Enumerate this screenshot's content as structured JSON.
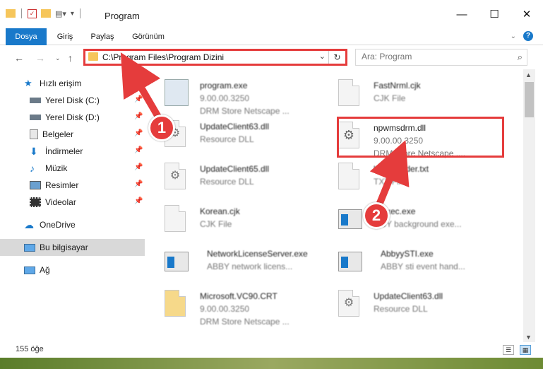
{
  "window": {
    "title": "Program"
  },
  "ribbon": {
    "tabs": [
      "Dosya",
      "Giriş",
      "Paylaş",
      "Görünüm"
    ]
  },
  "address": {
    "path": "C:\\Program Files\\Program Dizini"
  },
  "search": {
    "placeholder": "Ara: Program"
  },
  "sidebar": {
    "items": [
      {
        "label": "Hızlı erişim",
        "icon": "star-icon"
      },
      {
        "label": "Yerel Disk (C:)",
        "icon": "drive-icon"
      },
      {
        "label": "Yerel Disk (D:)",
        "icon": "drive-icon"
      },
      {
        "label": "Belgeler",
        "icon": "documents-icon"
      },
      {
        "label": "İndirmeler",
        "icon": "download-icon"
      },
      {
        "label": "Müzik",
        "icon": "music-icon"
      },
      {
        "label": "Resimler",
        "icon": "pictures-icon"
      },
      {
        "label": "Videolar",
        "icon": "video-icon"
      },
      {
        "label": "OneDrive",
        "icon": "cloud-icon"
      },
      {
        "label": "Bu bilgisayar",
        "icon": "computer-icon"
      },
      {
        "label": "Ağ",
        "icon": "network-icon"
      }
    ]
  },
  "files": [
    {
      "name": "program.exe",
      "line2": "9.00.00.3250",
      "line3": "DRM Store Netscape ...",
      "icon": "exe-icon"
    },
    {
      "name": "FastNrml.cjk",
      "line2": "CJK File",
      "line3": "",
      "icon": "document-icon"
    },
    {
      "name": "UpdateClient63.dll",
      "line2": "Resource DLL",
      "line3": "",
      "icon": "gear-doc-icon"
    },
    {
      "name": "npwmsdrm.dll",
      "line2": "9.00.00.3250",
      "line3": "DRM Store Netscape ....",
      "icon": "gear-doc-icon"
    },
    {
      "name": "UpdateClient65.dll",
      "line2": "Resource DLL",
      "line3": "",
      "icon": "gear-doc-icon"
    },
    {
      "name": "h...eReader.txt",
      "line2": "TXT File",
      "line3": "",
      "icon": "document-icon"
    },
    {
      "name": "Korean.cjk",
      "line2": "CJK File",
      "line3": "",
      "icon": "document-icon"
    },
    {
      "name": "...Exec.exe",
      "line2": "...BY background exe...",
      "line3": "",
      "icon": "app-icon"
    },
    {
      "name": "NetworkLicenseServer.exe",
      "line2": "ABBY network licens...",
      "line3": "",
      "icon": "app-icon"
    },
    {
      "name": "AbbyySTI.exe",
      "line2": "ABBY sti event hand...",
      "line3": "",
      "icon": "app-icon"
    },
    {
      "name": "Microsoft.VC90.CRT",
      "line2": "9.00.00.3250",
      "line3": "DRM Store Netscape ...",
      "icon": "folder-doc-icon"
    },
    {
      "name": "UpdateClient63.dll",
      "line2": "Resource DLL",
      "line3": "",
      "icon": "gear-doc-icon"
    }
  ],
  "status": {
    "count": "155 öğe"
  },
  "annotations": {
    "step1": "1",
    "step2": "2"
  },
  "colors": {
    "accent": "#1979ca",
    "annotation": "#e53c3c"
  }
}
